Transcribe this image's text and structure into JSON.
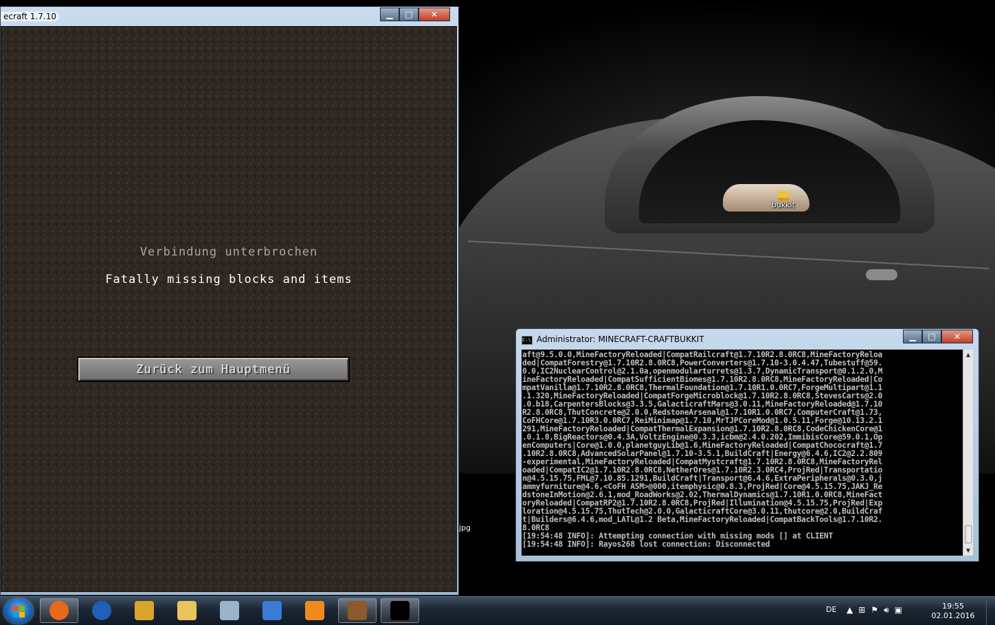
{
  "minecraft_window": {
    "title": "ecraft 1.7.10",
    "heading": "Verbindung unterbrochen",
    "message": "Fatally missing blocks and items",
    "button_label": "Zurück zum Hauptmenü",
    "controls": {
      "minimize": "▁",
      "maximize": "□",
      "close": "✕"
    }
  },
  "desktop": {
    "icons": [
      {
        "label": "bukkit",
        "icon": "folder-icon"
      }
    ],
    "partial_label": "jpg"
  },
  "cmd_window": {
    "title": "Administrator:  MINECRAFT-CRAFTBUKKIT",
    "controls": {
      "minimize": "▁",
      "maximize": "□",
      "close": "✕"
    },
    "lines": [
      "aft@9.5.0.0,MineFactoryReloaded|CompatRailcraft@1.7.10R2.8.0RC8,MineFactoryReloa",
      "ded|CompatForestry@1.7.10R2.8.0RC8,PowerConverters@1.7.10-3.0.4.47,Tubestuff@59.",
      "0.0,IC2NuclearControl@2.1.0a,openmodularturrets@1.3.7,DynamicTransport@0.1.2.0,M",
      "ineFactoryReloaded|CompatSufficientBiomes@1.7.10R2.8.0RC8,MineFactoryReloaded|Co",
      "mpatVanilla@1.7.10R2.8.0RC8,ThermalFoundation@1.7.10R1.0.0RC7,ForgeMultipart@1.1",
      ".1.320,MineFactoryReloaded|CompatForgeMicroblock@1.7.10R2.8.0RC8,StevesCarts@2.0",
      ".0.b18,CarpentersBlocks@3.3.5,GalacticraftMars@3.0.11,MineFactoryReloaded@1.7.10",
      "R2.8.0RC8,ThutConcrete@2.0.0,RedstoneArsenal@1.7.10R1.0.0RC7,ComputerCraft@1.73,",
      "CoFHCore@1.7.10R3.0.0RC7,ReiMinimap@1.7.10,MrTJPCoreMod@1.0.5.11,Forge@10.13.2.1",
      "291,MineFactoryReloaded|CompatThermalExpansion@1.7.10R2.8.0RC8,CodeChickenCore@1",
      ".0.1.8,BigReactors@0.4.3A,VoltzEngine@0.3.3,icbm@2.4.0.202,ImmibisCore@59.0.1,Op",
      "enComputers|Core@1.0.0,planetguyLib@1.6,MineFactoryReloaded|CompatChococraft@1.7",
      ".10R2.8.0RC8,AdvancedSolarPanel@1.7.10-3.5.1,BuildCraft|Energy@6.4.6,IC2@2.2.809",
      "-experimental,MineFactoryReloaded|CompatMystcraft@1.7.10R2.8.0RC8,MineFactoryRel",
      "oaded|CompatIC2@1.7.10R2.8.0RC8,NetherOres@1.7.10R2.3.0RC4,ProjRed|Transportatio",
      "n@4.5.15.75,FML@7.10.85.1291,BuildCraft|Transport@6.4.6,ExtraPeripherals@0.3.0,j",
      "ammyfurniture@4.6,<CoFH ASM>@000,itemphysic@0.8.3,ProjRed|Core@4.5.15.75,JAKJ_Re",
      "dstoneInMotion@2.6.1,mod_RoadWorks@2.02,ThermalDynamics@1.7.10R1.0.0RC8,MineFact",
      "oryReloaded|CompatRP2@1.7.10R2.8.0RC8,ProjRed|Illumination@4.5.15.75,ProjRed|Exp",
      "loration@4.5.15.75,ThutTech@2.0.0,GalacticraftCore@3.0.11,thutcore@2.0,BuildCraf",
      "t|Builders@6.4.6,mod_LATL@1.2 Beta,MineFactoryReloaded|CompatBackTools@1.7.10R2.",
      "8.0RC8",
      "[19:54:48 INFO]: Attempting connection with missing mods [] at CLIENT",
      "[19:54:48 INFO]: Rayos268 lost connection: Disconnected"
    ],
    "cursor": "_"
  },
  "taskbar": {
    "items": [
      {
        "name": "firefox",
        "icon": "firefox-icon",
        "color": "#e8691c",
        "active": true
      },
      {
        "name": "globe",
        "icon": "globe-icon",
        "color": "#1f5fb8",
        "active": false
      },
      {
        "name": "winamp",
        "icon": "winamp-icon",
        "color": "#d9a52a",
        "active": false
      },
      {
        "name": "explorer",
        "icon": "folder-icon",
        "color": "#e9c45a",
        "active": false
      },
      {
        "name": "calculator",
        "icon": "calculator-icon",
        "color": "#9ab4cc",
        "active": false
      },
      {
        "name": "remote-desktop",
        "icon": "remote-desktop-icon",
        "color": "#3a7bd5",
        "active": false
      },
      {
        "name": "media-player",
        "icon": "media-player-icon",
        "color": "#f08a1c",
        "active": false
      },
      {
        "name": "minecraft",
        "icon": "crafting-table-icon",
        "color": "#8a5a2b",
        "active": true
      },
      {
        "name": "cmd",
        "icon": "cmd-icon",
        "color": "#000000",
        "active": true
      }
    ],
    "language": "DE",
    "clock": {
      "time": "19:55",
      "date": "02.01.2016"
    }
  }
}
